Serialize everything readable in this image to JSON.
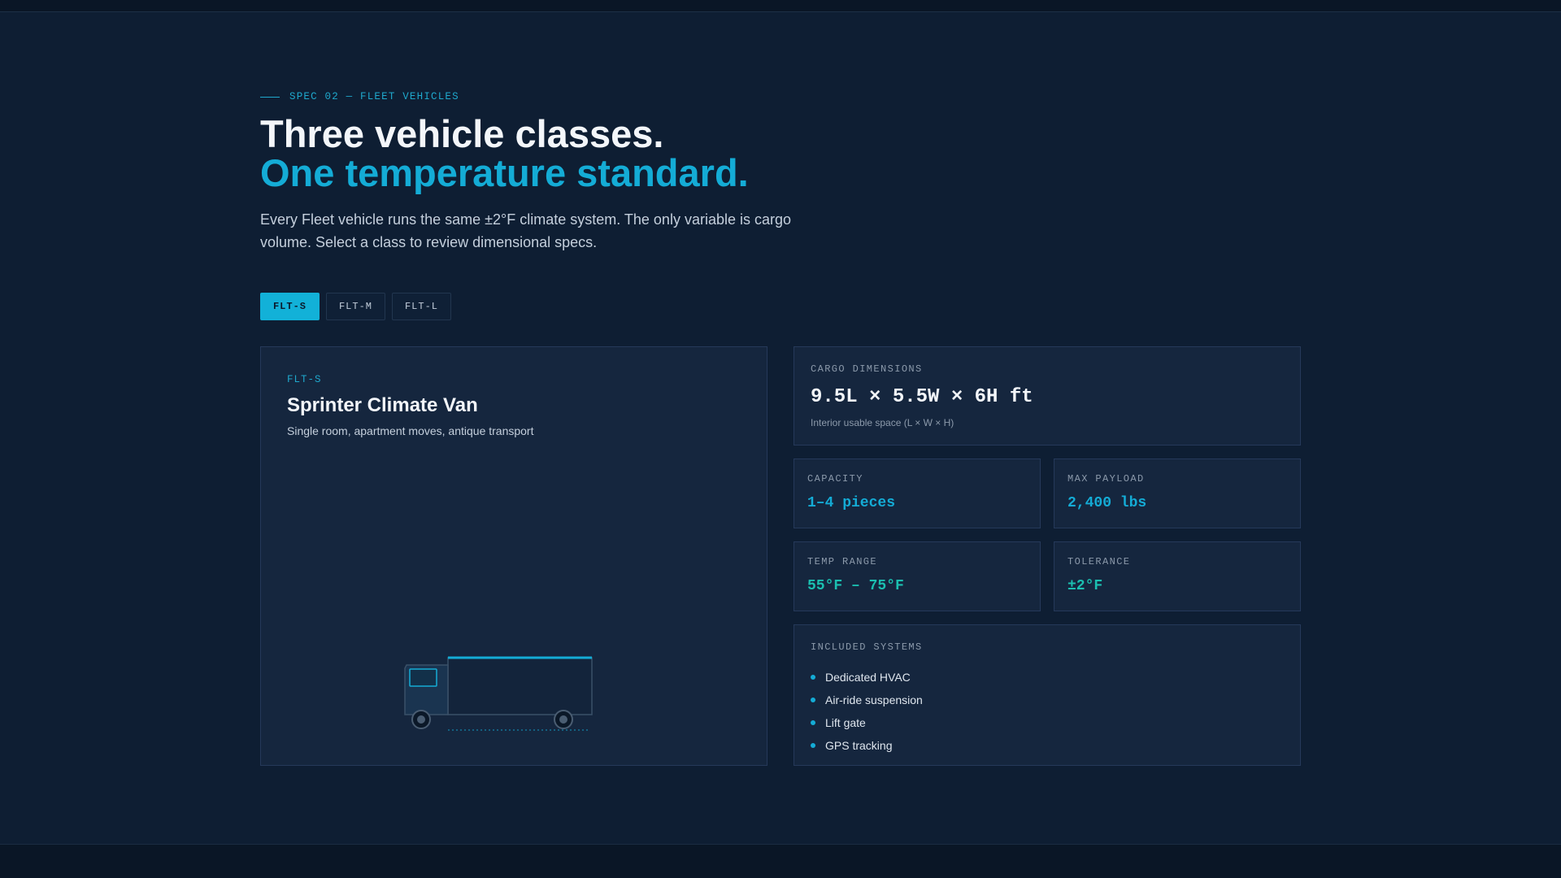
{
  "section": {
    "eyebrow": "SPEC 02 — FLEET VEHICLES",
    "headline_line1": "Three vehicle classes.",
    "headline_line2": "One temperature standard.",
    "lead": "Every Fleet vehicle runs the same ±2°F climate system. The only variable is cargo volume. Select a class to review dimensional specs."
  },
  "tabs": [
    {
      "label": "FLT-S",
      "active": true
    },
    {
      "label": "FLT-M",
      "active": false
    },
    {
      "label": "FLT-L",
      "active": false
    }
  ],
  "vehicle": {
    "code": "FLT-S",
    "name": "Sprinter Climate Van",
    "description": "Single room, apartment moves, antique transport",
    "illustration_icon": "van-icon"
  },
  "specs": {
    "dimensions": {
      "label": "CARGO DIMENSIONS",
      "value": "9.5L × 5.5W × 6H ft",
      "note": "Interior usable space (L × W × H)"
    },
    "capacity": {
      "label": "CAPACITY",
      "value": "1–4 pieces"
    },
    "payload": {
      "label": "MAX PAYLOAD",
      "value": "2,400 lbs"
    },
    "temp_range": {
      "label": "TEMP RANGE",
      "value": "55°F – 75°F"
    },
    "tolerance": {
      "label": "TOLERANCE",
      "value": "±2°F"
    },
    "systems": {
      "label": "INCLUDED SYSTEMS",
      "items": [
        "Dedicated HVAC",
        "Air-ride suspension",
        "Lift gate",
        "GPS tracking"
      ]
    }
  },
  "colors": {
    "background": "#0e1e33",
    "card": "#15263e",
    "accent": "#14acd6",
    "teal": "#1bbfb0"
  }
}
